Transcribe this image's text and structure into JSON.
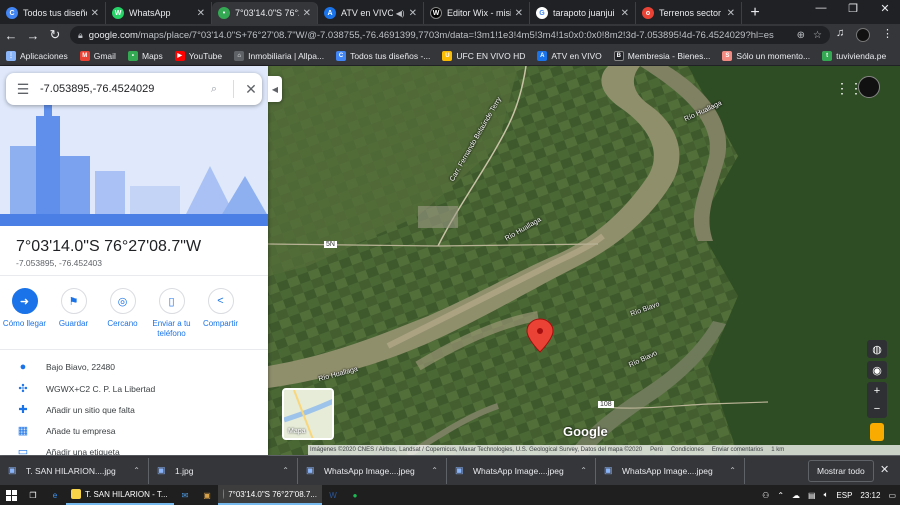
{
  "browser": {
    "tabs": [
      {
        "title": "Todos tus diseños",
        "color": "#4285f4",
        "glyph": "C",
        "active": false
      },
      {
        "title": "WhatsApp",
        "color": "#25d366",
        "glyph": "W",
        "active": false
      },
      {
        "title": "7°03'14.0\"S 76°27'0",
        "color": "#34a853",
        "glyph": "•",
        "active": true
      },
      {
        "title": "ATV en VIVO",
        "color": "#1a73e8",
        "glyph": "A",
        "active": false,
        "audio": true
      },
      {
        "title": "Editor Wix - misitio",
        "color": "#000000",
        "glyph": "W",
        "active": false
      },
      {
        "title": "tarapoto juanjui -",
        "color": "#ffffff",
        "glyph": "G",
        "active": false
      },
      {
        "title": "Terrenos sector ba",
        "color": "#ea4335",
        "glyph": "o",
        "active": false
      }
    ],
    "new_tab": "+",
    "window_controls": [
      "—",
      "❐",
      "✕"
    ],
    "url_host": "google.com",
    "url_path": "/maps/place/7°03'14.0\"S+76°27'08.7\"W/@-7.038755,-76.4691399,7703m/data=!3m1!1e3!4m5!3m4!1s0x0:0x0!8m2!3d-7.053895!4d-76.4524029?hl=es",
    "bookmarks": [
      {
        "label": "Aplicaciones",
        "color": "#8ab4f8",
        "glyph": "⋮"
      },
      {
        "label": "Gmail",
        "color": "#ea4335",
        "glyph": "M"
      },
      {
        "label": "Maps",
        "color": "#34a853",
        "glyph": "•"
      },
      {
        "label": "YouTube",
        "color": "#ff0000",
        "glyph": "▶"
      },
      {
        "label": "Inmobiliaria | Allpa...",
        "color": "#5f6368",
        "glyph": "⌂"
      },
      {
        "label": "Todos tus diseños -...",
        "color": "#4285f4",
        "glyph": "C"
      },
      {
        "label": "UFC EN VIVO HD",
        "color": "#fbbc04",
        "glyph": "U"
      },
      {
        "label": "ATV en VIVO",
        "color": "#1a73e8",
        "glyph": "A"
      },
      {
        "label": "Membresia - Bienes...",
        "color": "#202124",
        "glyph": "B"
      },
      {
        "label": "Sólo un momento...",
        "color": "#f28b82",
        "glyph": "S"
      },
      {
        "label": "tuvivienda.pe",
        "color": "#34a853",
        "glyph": "t"
      }
    ]
  },
  "maps": {
    "search_value": "-7.053895,-76.4524029",
    "title": "7°03'14.0\"S 76°27'08.7\"W",
    "subtitle": "-7.053895, -76.452403",
    "actions": [
      {
        "label": "Cómo llegar",
        "icon": "directions-icon",
        "glyph": "➜",
        "filled": true
      },
      {
        "label": "Guardar",
        "icon": "bookmark-icon",
        "glyph": "⚑",
        "filled": false
      },
      {
        "label": "Cercano",
        "icon": "nearby-icon",
        "glyph": "◎",
        "filled": false
      },
      {
        "label": "Enviar a tu teléfono",
        "icon": "send-to-phone-icon",
        "glyph": "▯",
        "filled": false
      },
      {
        "label": "Compartir",
        "icon": "share-icon",
        "glyph": "<",
        "filled": false
      }
    ],
    "info_rows": [
      {
        "text": "Bajo Biavo, 22480",
        "icon": "location-pin-icon",
        "glyph": "●"
      },
      {
        "text": "WGWX+C2 C. P. La Libertad",
        "icon": "plus-code-icon",
        "glyph": "✣"
      },
      {
        "text": "Añadir un sitio que falta",
        "icon": "add-place-icon",
        "glyph": "✚"
      },
      {
        "text": "Añade tu empresa",
        "icon": "business-icon",
        "glyph": "▦"
      },
      {
        "text": "Añadir una etiqueta",
        "icon": "label-icon",
        "glyph": "▭"
      }
    ],
    "map_labels": [
      {
        "text": "Río Huallaga"
      },
      {
        "text": "Río Huallaga"
      },
      {
        "text": "Río Biavo"
      },
      {
        "text": "Río Biavo"
      },
      {
        "text": "Carr. Fernando Belaúnde Terry"
      },
      {
        "text": "5N"
      },
      {
        "text": "108"
      },
      {
        "text": "Río Huallaga"
      }
    ],
    "layers_label": "Mapa",
    "logo": "Google",
    "attribution": [
      "Imágenes ©2020 CNES / Airbus, Landsat / Copernicus, Maxar Technologies, U.S. Geological Survey, Datos del mapa ©2020",
      "Perú",
      "Condiciones",
      "Enviar comentarios",
      "1 km"
    ],
    "marker_color": "#ea4335"
  },
  "downloads": {
    "items": [
      {
        "name": "T. SAN HILARION....jpg"
      },
      {
        "name": "1.jpg"
      },
      {
        "name": "WhatsApp Image....jpeg"
      },
      {
        "name": "WhatsApp Image....jpeg"
      },
      {
        "name": "WhatsApp Image....jpeg"
      }
    ],
    "show_all": "Mostrar todo"
  },
  "taskbar": {
    "items": [
      {
        "label": "T. SAN HILARION - T...",
        "color": "#f9d649"
      },
      {
        "label": "7°03'14.0\"S 76°27'08.7...",
        "color": "#34a853"
      }
    ],
    "lang": "ESP",
    "time": "23:12"
  }
}
